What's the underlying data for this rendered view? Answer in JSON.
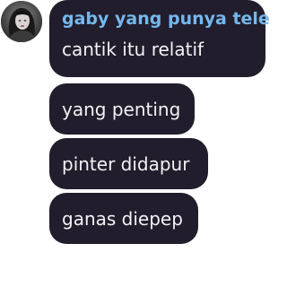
{
  "sender": {
    "name": "gaby yang punya tele",
    "name_color": "#74b8ee"
  },
  "avatar": {
    "icon": "profile-photo"
  },
  "messages": [
    {
      "text": "cantik itu relatif"
    },
    {
      "text": "yang penting"
    },
    {
      "text": "pinter didapur"
    },
    {
      "text": "ganas diepep"
    }
  ],
  "colors": {
    "bubble_background": "#221d2c",
    "message_text": "#f2f2f4",
    "page_background": "#ffffff"
  }
}
